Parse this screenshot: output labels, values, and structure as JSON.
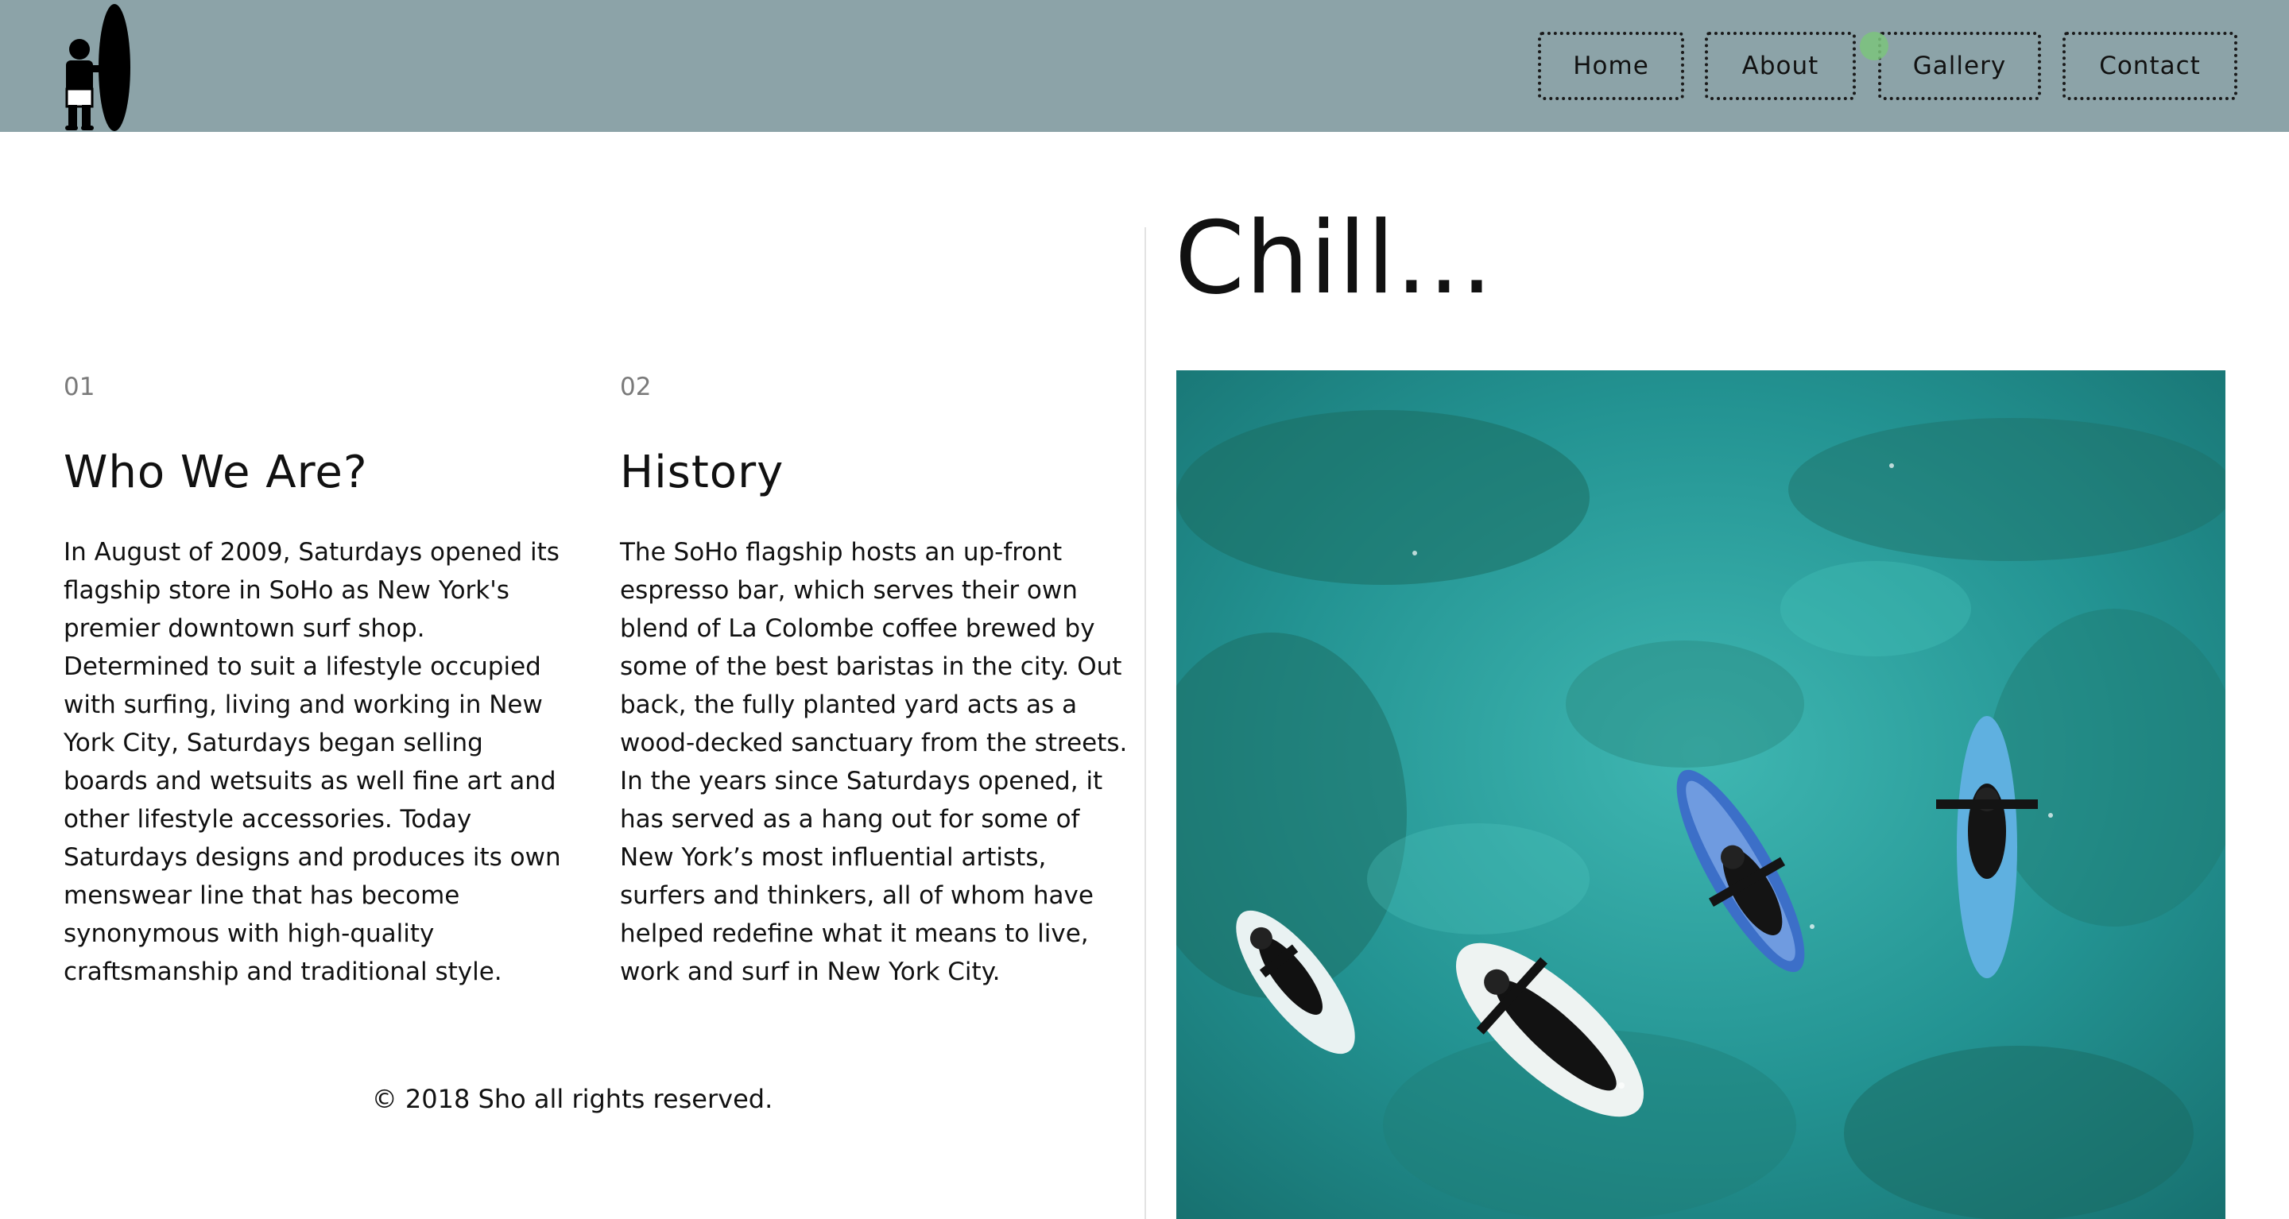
{
  "header": {
    "logo_icon": "surfer-with-surfboard-icon",
    "nav": [
      {
        "label": "Home"
      },
      {
        "label": "About"
      },
      {
        "label": "Gallery"
      },
      {
        "label": "Contact"
      }
    ]
  },
  "sections": [
    {
      "number": "01",
      "title": "Who We Are?",
      "body": "In August of 2009, Saturdays opened its flagship store in SoHo as New York's premier downtown surf shop. Determined to suit a lifestyle occupied with surfing, living and working in New York City, Saturdays began selling boards and wetsuits as well fine art and other lifestyle accessories. Today Saturdays designs and produces its own menswear line that has become synonymous with high-quality craftsmanship and traditional style."
    },
    {
      "number": "02",
      "title": "History",
      "body": "The SoHo flagship hosts an up-front espresso bar, which serves their own blend of La Colombe coffee brewed by some of the best baristas in the city. Out back, the fully planted yard acts as a wood-decked sanctuary from the streets. In the years since Saturdays opened, it has served as a hang out for some of New York’s most influential artists, surfers and thinkers, all of whom have helped redefine what it means to live, work and surf in New York City."
    }
  ],
  "footer": {
    "copyright": "© 2018 Sho all rights reserved."
  },
  "feature": {
    "heading": "Chill...",
    "image_icon": "aerial-surfers-photo"
  },
  "colors": {
    "header_bg": "#8ca3a8",
    "water": "#2a9a9a",
    "text": "#111111"
  }
}
